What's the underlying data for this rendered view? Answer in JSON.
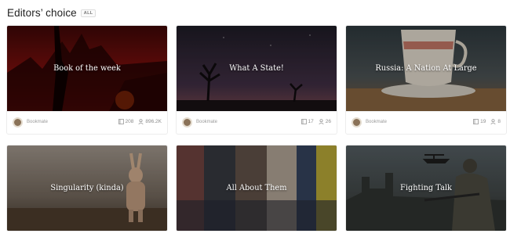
{
  "header": {
    "title": "Editors’ choice",
    "all_label": "ALL"
  },
  "colors": {
    "card_bg": "#ffffff",
    "overlay_text": "#ffffff",
    "stat_text": "#8c8c8c"
  },
  "cards": [
    {
      "title": "Book of the week",
      "publisher": "Bookmate",
      "books": "208",
      "followers": "896.2K"
    },
    {
      "title": "What A State!",
      "publisher": "Bookmate",
      "books": "17",
      "followers": "26"
    },
    {
      "title": "Russia: A Nation At Large",
      "publisher": "Bookmate",
      "books": "19",
      "followers": "8"
    },
    {
      "title": "Singularity (kinda)"
    },
    {
      "title": "All About Them"
    },
    {
      "title": "Fighting Talk"
    }
  ]
}
